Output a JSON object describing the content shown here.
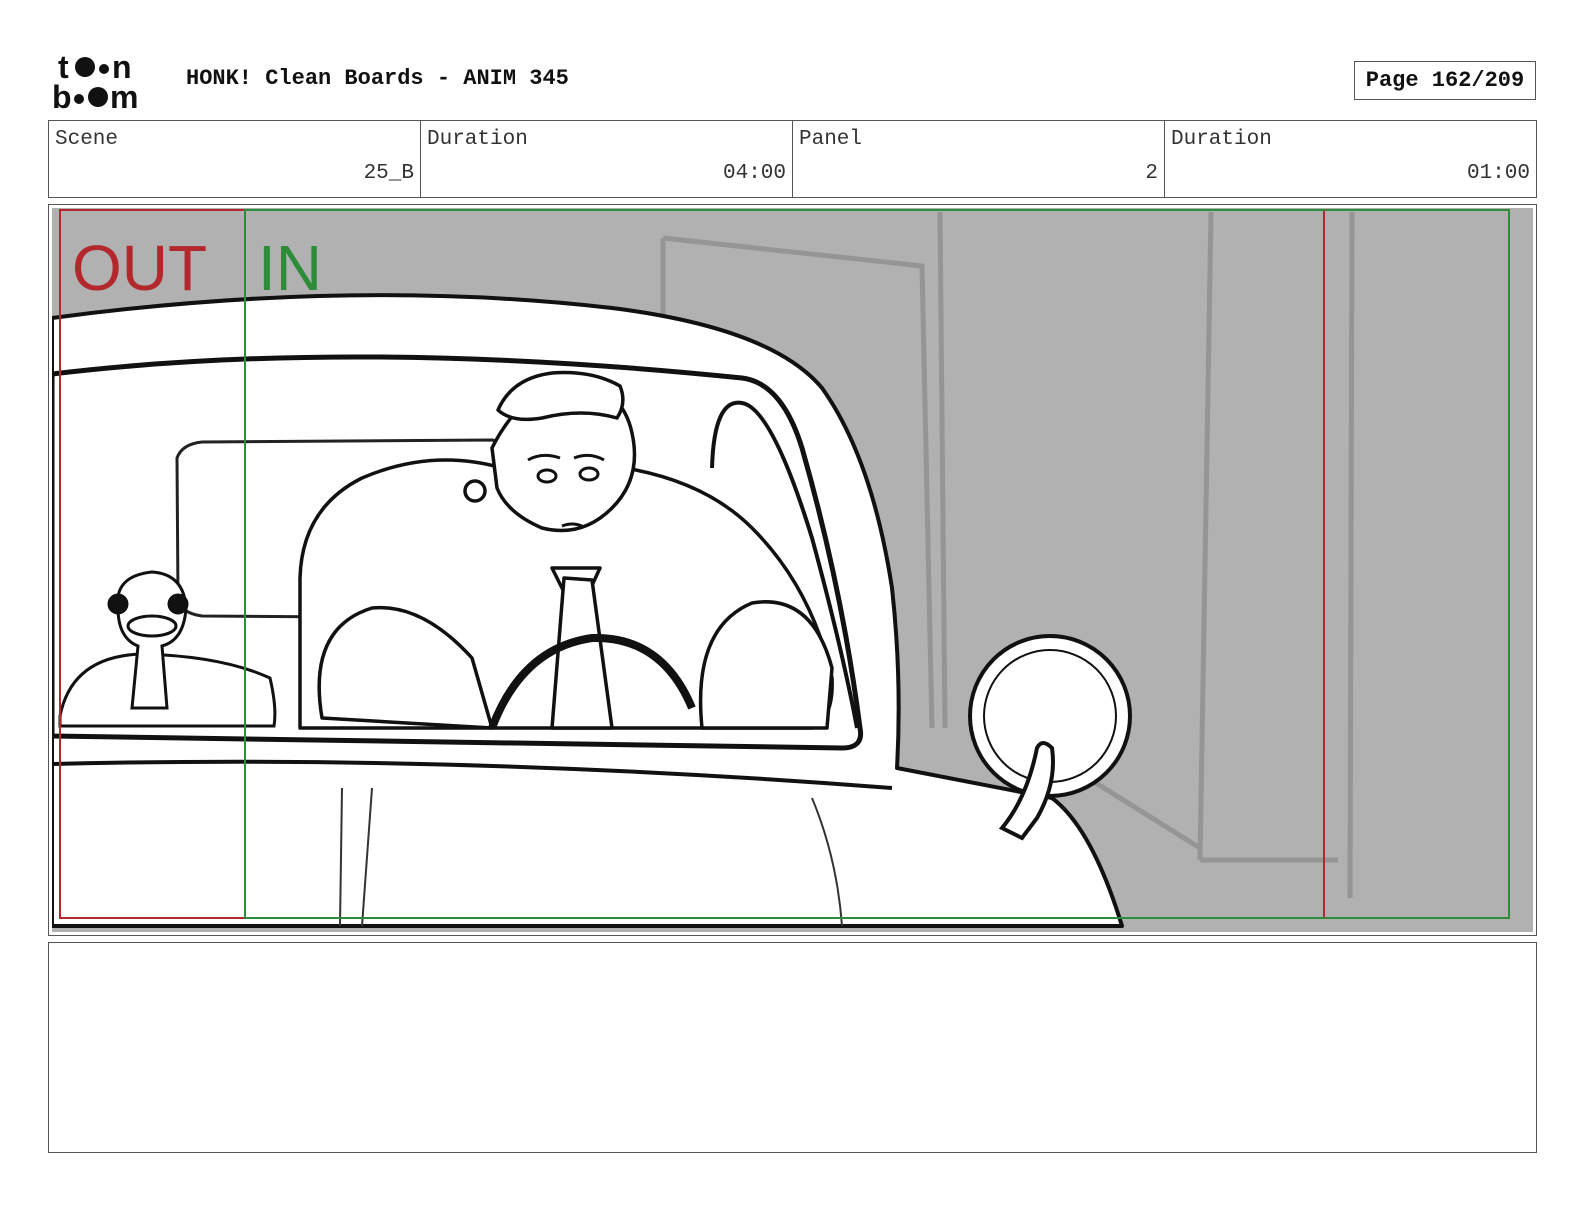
{
  "header": {
    "logo_alt": "toon boom",
    "title": "HONK! Clean Boards - ANIM 345",
    "page_label": "Page 162/209"
  },
  "info": [
    {
      "label": "Scene",
      "value": "25_B"
    },
    {
      "label": "Duration",
      "value": "04:00"
    },
    {
      "label": "Panel",
      "value": "2"
    },
    {
      "label": "Duration",
      "value": "01:00"
    }
  ],
  "panel": {
    "out_label": "OUT",
    "in_label": "IN",
    "colors": {
      "out_frame": "#b3282d",
      "in_frame": "#2e8b3a",
      "background": "#b1b1b1"
    }
  },
  "notes": {
    "text": ""
  }
}
